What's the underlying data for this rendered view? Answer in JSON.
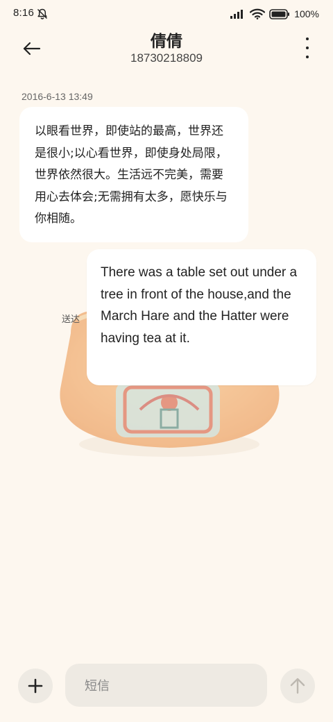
{
  "status_bar": {
    "time": "8:16",
    "battery": "100%",
    "icons": [
      "bell-muted-icon",
      "signal-icon",
      "wifi-icon",
      "battery-icon"
    ]
  },
  "header": {
    "contact_name": "倩倩",
    "contact_number": "18730218809",
    "icons": [
      "back-arrow-icon",
      "more-vert-icon"
    ]
  },
  "conversation": {
    "timestamp": "2016-6-13 13:49",
    "incoming_message": "以眼看世界，即使站的最高，世界还是很小;以心看世界，即使身处局限，世界依然很大。生活远不完美，需要用心去体会;无需拥有太多，愿快乐与你相随。",
    "outgoing_message": "There was a table set out under a tree in front of the house,and the March Hare and the Hatter were having tea at it.",
    "delivery_status": "送达"
  },
  "composer": {
    "placeholder": "短信",
    "icons": [
      "plus-icon",
      "send-arrow-icon"
    ]
  },
  "colors": {
    "background": "#fdf7ef",
    "bubble": "#ffffff",
    "input_bg": "#eeeae3",
    "watermark_orange": "#f0a25a"
  }
}
